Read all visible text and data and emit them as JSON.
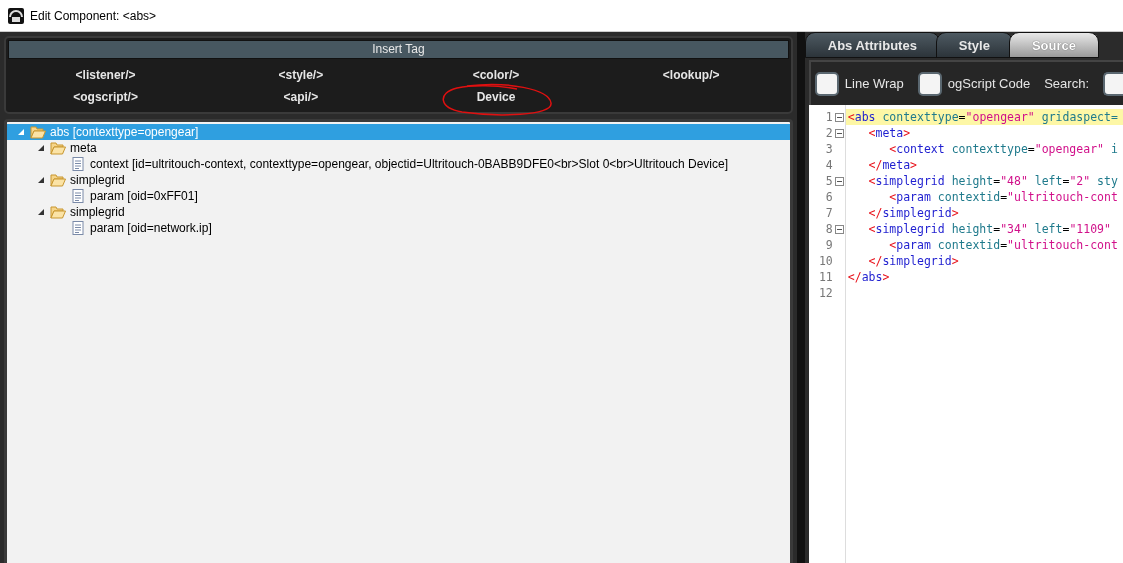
{
  "window": {
    "title": "Edit Component: <abs>"
  },
  "insert_tag": {
    "title": "Insert Tag",
    "items": [
      "<listener/>",
      "<style/>",
      "<color/>",
      "<lookup/>",
      "<ogscript/>",
      "<api/>",
      "Device"
    ]
  },
  "tree": [
    {
      "label": "abs [contexttype=opengear]",
      "selected": true,
      "expanded": true,
      "children": [
        {
          "label": "meta",
          "selected": false,
          "expanded": true,
          "children": [
            {
              "label": "context [id=ultritouch-context, contexttype=opengear, objectid=Ultritouch-0BABB9DFE0<br>Slot 0<br>Ultritouch Device]",
              "selected": false
            }
          ]
        },
        {
          "label": "simplegrid",
          "selected": false,
          "expanded": true,
          "children": [
            {
              "label": "param [oid=0xFF01]",
              "selected": false
            }
          ]
        },
        {
          "label": "simplegrid",
          "selected": false,
          "expanded": true,
          "children": [
            {
              "label": "param [oid=network.ip]",
              "selected": false
            }
          ]
        }
      ]
    }
  ],
  "tabs": [
    {
      "label": "Abs Attributes",
      "selected": false
    },
    {
      "label": "Style",
      "selected": false
    },
    {
      "label": "Source",
      "selected": true
    }
  ],
  "toolbar": {
    "line_wrap": {
      "label": "Line Wrap",
      "checked": false
    },
    "ogscript_code": {
      "label": "ogScript Code",
      "checked": false
    },
    "search_label": "Search:"
  },
  "editor": {
    "lines": [
      {
        "number": "1",
        "foldable": true,
        "highlighted": true,
        "tokens": [
          {
            "kind": "bracket",
            "text": "<"
          },
          {
            "kind": "tag",
            "text": "abs"
          },
          {
            "kind": "attr",
            "text": " contexttype"
          },
          {
            "kind": "plain",
            "text": "="
          },
          {
            "kind": "value",
            "text": "\"opengear\""
          },
          {
            "kind": "attr",
            "text": " gridaspect="
          }
        ]
      },
      {
        "number": "2",
        "foldable": true,
        "highlighted": false,
        "tokens": [
          {
            "kind": "bracket",
            "text": "   <"
          },
          {
            "kind": "tag",
            "text": "meta"
          },
          {
            "kind": "bracket",
            "text": ">"
          }
        ]
      },
      {
        "number": "3",
        "foldable": false,
        "highlighted": false,
        "tokens": [
          {
            "kind": "bracket",
            "text": "      <"
          },
          {
            "kind": "tag",
            "text": "context"
          },
          {
            "kind": "attr",
            "text": " contexttype"
          },
          {
            "kind": "plain",
            "text": "="
          },
          {
            "kind": "value",
            "text": "\"opengear\""
          },
          {
            "kind": "attr",
            "text": " i"
          }
        ]
      },
      {
        "number": "4",
        "foldable": false,
        "highlighted": false,
        "tokens": [
          {
            "kind": "bracket",
            "text": "   </"
          },
          {
            "kind": "tag",
            "text": "meta"
          },
          {
            "kind": "bracket",
            "text": ">"
          }
        ]
      },
      {
        "number": "5",
        "foldable": true,
        "highlighted": false,
        "tokens": [
          {
            "kind": "bracket",
            "text": "   <"
          },
          {
            "kind": "tag",
            "text": "simplegrid"
          },
          {
            "kind": "attr",
            "text": " height"
          },
          {
            "kind": "plain",
            "text": "="
          },
          {
            "kind": "value",
            "text": "\"48\""
          },
          {
            "kind": "attr",
            "text": " left"
          },
          {
            "kind": "plain",
            "text": "="
          },
          {
            "kind": "value",
            "text": "\"2\""
          },
          {
            "kind": "attr",
            "text": " sty"
          }
        ]
      },
      {
        "number": "6",
        "foldable": false,
        "highlighted": false,
        "tokens": [
          {
            "kind": "bracket",
            "text": "      <"
          },
          {
            "kind": "tag",
            "text": "param"
          },
          {
            "kind": "attr",
            "text": " contextid"
          },
          {
            "kind": "plain",
            "text": "="
          },
          {
            "kind": "value",
            "text": "\"ultritouch-cont"
          }
        ]
      },
      {
        "number": "7",
        "foldable": false,
        "highlighted": false,
        "tokens": [
          {
            "kind": "bracket",
            "text": "   </"
          },
          {
            "kind": "tag",
            "text": "simplegrid"
          },
          {
            "kind": "bracket",
            "text": ">"
          }
        ]
      },
      {
        "number": "8",
        "foldable": true,
        "highlighted": false,
        "tokens": [
          {
            "kind": "bracket",
            "text": "   <"
          },
          {
            "kind": "tag",
            "text": "simplegrid"
          },
          {
            "kind": "attr",
            "text": " height"
          },
          {
            "kind": "plain",
            "text": "="
          },
          {
            "kind": "value",
            "text": "\"34\""
          },
          {
            "kind": "attr",
            "text": " left"
          },
          {
            "kind": "plain",
            "text": "="
          },
          {
            "kind": "value",
            "text": "\"1109\""
          }
        ]
      },
      {
        "number": "9",
        "foldable": false,
        "highlighted": false,
        "tokens": [
          {
            "kind": "bracket",
            "text": "      <"
          },
          {
            "kind": "tag",
            "text": "param"
          },
          {
            "kind": "attr",
            "text": " contextid"
          },
          {
            "kind": "plain",
            "text": "="
          },
          {
            "kind": "value",
            "text": "\"ultritouch-cont"
          }
        ]
      },
      {
        "number": "10",
        "foldable": false,
        "highlighted": false,
        "tokens": [
          {
            "kind": "bracket",
            "text": "   </"
          },
          {
            "kind": "tag",
            "text": "simplegrid"
          },
          {
            "kind": "bracket",
            "text": ">"
          }
        ]
      },
      {
        "number": "11",
        "foldable": false,
        "highlighted": false,
        "tokens": [
          {
            "kind": "bracket",
            "text": "</"
          },
          {
            "kind": "tag",
            "text": "abs"
          },
          {
            "kind": "bracket",
            "text": ">"
          }
        ]
      },
      {
        "number": "12",
        "foldable": false,
        "highlighted": false
      }
    ]
  }
}
